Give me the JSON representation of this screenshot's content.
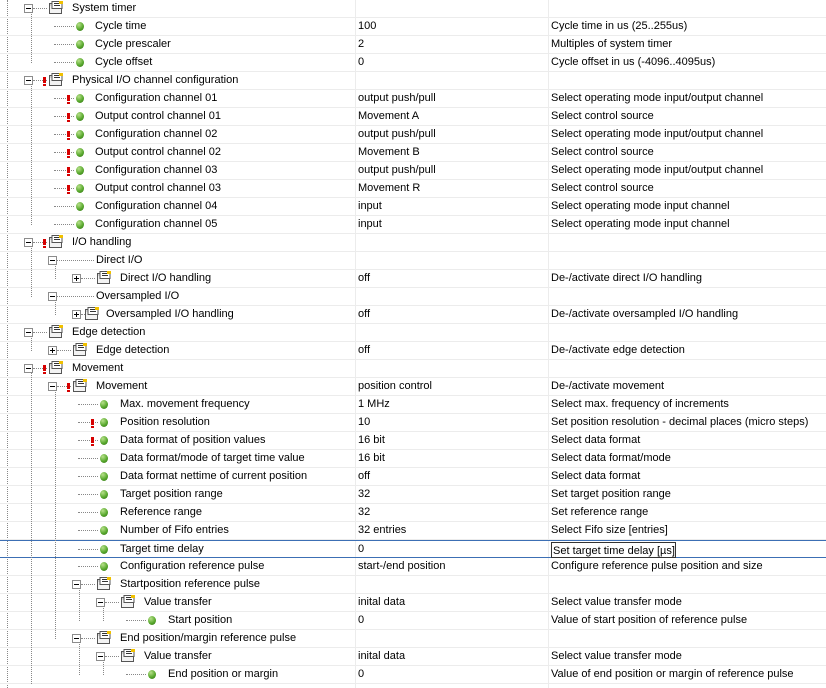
{
  "tree": {
    "rows": [
      {
        "label": "System timer",
        "value": "",
        "description": ""
      },
      {
        "label": "Cycle time",
        "value": "100",
        "description": "Cycle time in us (25..255us)"
      },
      {
        "label": "Cycle prescaler",
        "value": "2",
        "description": "Multiples of system timer"
      },
      {
        "label": "Cycle offset",
        "value": "0",
        "description": "Cycle offset in us (-4096..4095us)"
      },
      {
        "label": "Physical I/O channel configuration",
        "value": "",
        "description": ""
      },
      {
        "label": "Configuration channel 01",
        "value": "output push/pull",
        "description": "Select operating mode input/output channel"
      },
      {
        "label": "Output control channel 01",
        "value": "Movement A",
        "description": "Select control source"
      },
      {
        "label": "Configuration channel 02",
        "value": "output push/pull",
        "description": "Select operating mode input/output channel"
      },
      {
        "label": "Output control channel 02",
        "value": "Movement B",
        "description": "Select control source"
      },
      {
        "label": "Configuration channel 03",
        "value": "output push/pull",
        "description": "Select operating mode input/output channel"
      },
      {
        "label": "Output control channel 03",
        "value": "Movement R",
        "description": "Select control source"
      },
      {
        "label": "Configuration channel 04",
        "value": "input",
        "description": "Select operating mode input channel"
      },
      {
        "label": "Configuration channel 05",
        "value": "input",
        "description": "Select operating mode input channel"
      },
      {
        "label": "I/O handling",
        "value": "",
        "description": ""
      },
      {
        "label": "Direct I/O",
        "value": "",
        "description": ""
      },
      {
        "label": "Direct I/O handling",
        "value": "off",
        "description": "De-/activate direct I/O handling"
      },
      {
        "label": "Oversampled I/O",
        "value": "",
        "description": ""
      },
      {
        "label": "Oversampled I/O handling",
        "value": "off",
        "description": "De-/activate oversampled I/O handling"
      },
      {
        "label": "Edge detection",
        "value": "",
        "description": ""
      },
      {
        "label": "Edge detection",
        "value": "off",
        "description": "De-/activate edge detection"
      },
      {
        "label": "Movement",
        "value": "",
        "description": ""
      },
      {
        "label": "Movement",
        "value": "position control",
        "description": "De-/activate movement"
      },
      {
        "label": "Max. movement frequency",
        "value": "1 MHz",
        "description": "Select max. frequency of increments"
      },
      {
        "label": "Position resolution",
        "value": "10",
        "description": "Set position resolution - decimal places (micro steps)"
      },
      {
        "label": "Data format of position values",
        "value": "16 bit",
        "description": "Select data format"
      },
      {
        "label": "Data format/mode of target time value",
        "value": "16 bit",
        "description": "Select data format/mode"
      },
      {
        "label": "Data format nettime of current position",
        "value": "off",
        "description": "Select data format"
      },
      {
        "label": "Target position range",
        "value": "32",
        "description": "Set target position range"
      },
      {
        "label": "Reference range",
        "value": "32",
        "description": "Set reference range"
      },
      {
        "label": "Number of Fifo entries",
        "value": "32 entries",
        "description": "Select Fifo size [entries]"
      },
      {
        "label": "Target time delay",
        "value": "0",
        "description": "Set target time delay [µs]"
      },
      {
        "label": "Configuration reference pulse",
        "value": "start-/end position",
        "description": "Configure reference pulse position and size"
      },
      {
        "label": "Startposition reference pulse",
        "value": "",
        "description": ""
      },
      {
        "label": "Value transfer",
        "value": "inital data",
        "description": "Select value transfer mode"
      },
      {
        "label": "Start position",
        "value": "0",
        "description": "Value of start position of reference pulse"
      },
      {
        "label": "End position/margin reference pulse",
        "value": "",
        "description": ""
      },
      {
        "label": "Value transfer",
        "value": "inital data",
        "description": "Select value transfer mode"
      },
      {
        "label": "End position or margin",
        "value": "0",
        "description": "Value of end position or margin of reference pulse"
      }
    ]
  },
  "icons": {
    "folder": "parameter-folder-icon",
    "leaf": "green-parameter-icon",
    "warning": "red-warning-marker-icon",
    "expand": "tree-expand-icon",
    "collapse": "tree-collapse-icon"
  },
  "colors": {
    "background": "#ffffff",
    "grid_line": "#ececec",
    "selection_line": "#3c6fb4",
    "leaf_green": "#59a92e",
    "warning_red": "#d60000"
  }
}
